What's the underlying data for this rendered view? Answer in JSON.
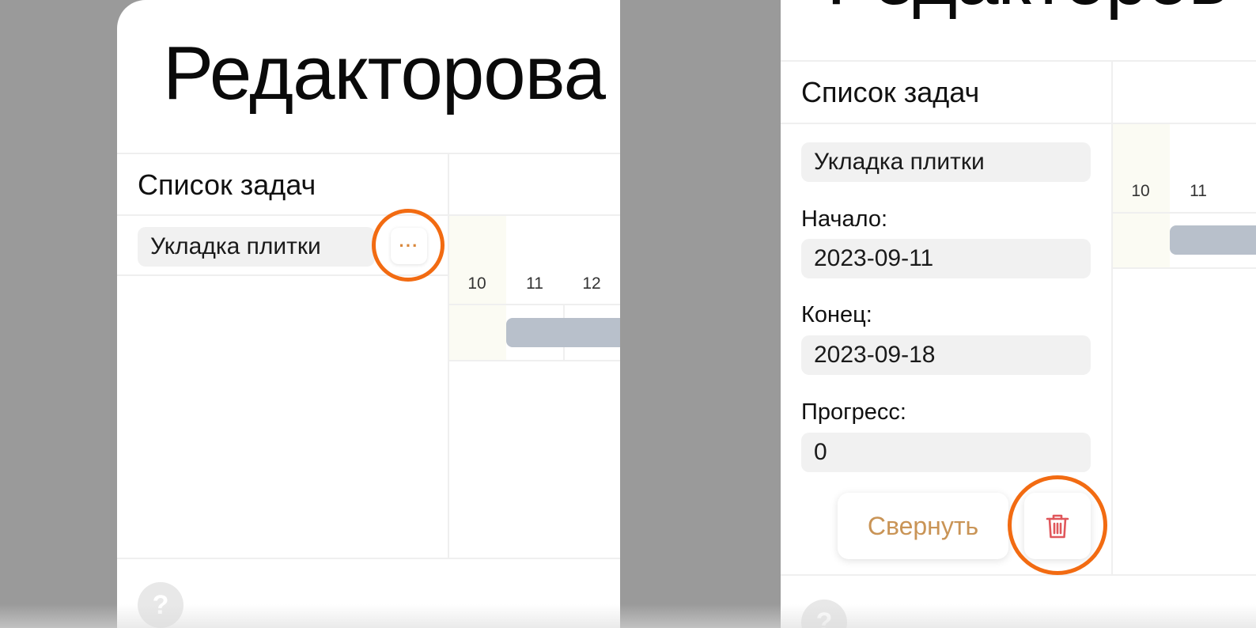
{
  "left_panel": {
    "title": "Редакторова",
    "task_list_title": "Список задач",
    "task_name": "Укладка плитки",
    "more_button": "···",
    "days": [
      "10",
      "11",
      "12"
    ],
    "help_label": "?"
  },
  "right_panel": {
    "title": "Редакторов",
    "task_list_title": "Список задач",
    "task_name_value": "Укладка плитки",
    "start_label": "Начало:",
    "start_value": "2023-09-11",
    "end_label": "Конец:",
    "end_value": "2023-09-18",
    "progress_label": "Прогресс:",
    "progress_value": "0",
    "collapse_label": "Свернуть",
    "days": [
      "10",
      "11"
    ],
    "help_label": "?"
  },
  "colors": {
    "highlight_ring": "#f26b12",
    "accent_text": "#c99456",
    "delete_icon": "#e0575b",
    "task_bar": "#b8c0cb",
    "backdrop": "#9a9a9a"
  },
  "icons": [
    "more-dots-icon",
    "trash-icon",
    "help-icon"
  ]
}
